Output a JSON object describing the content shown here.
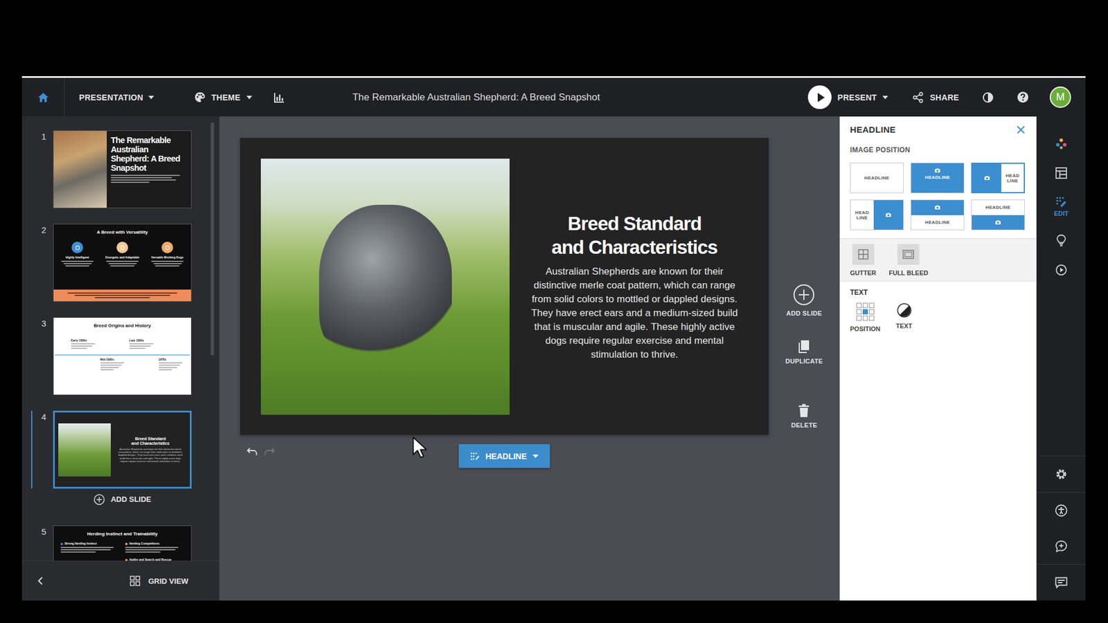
{
  "top_bar": {
    "presentation_menu": "PRESENTATION",
    "theme_menu": "THEME",
    "title": "The Remarkable Australian Shepherd: A Breed Snapshot",
    "present": "PRESENT",
    "share": "SHARE",
    "avatar": "M"
  },
  "sidebar": {
    "slides": [
      {
        "number": "1",
        "kind": "title",
        "selected": false,
        "title": "The Remarkable Australian Shepherd: A Breed Snapshot"
      },
      {
        "number": "2",
        "kind": "three-icons",
        "selected": false,
        "title": "A Breed with Versatility",
        "items": [
          {
            "label": "Highly Intelligent",
            "color": "#3d8fd6"
          },
          {
            "label": "Energetic and Adaptable",
            "color": "#f5c894"
          },
          {
            "label": "Versatile Working Dogs",
            "color": "#f1a96a"
          }
        ]
      },
      {
        "number": "3",
        "kind": "timeline",
        "selected": false,
        "title": "Breed Origins and History",
        "items": [
          {
            "label": "Early 1800s"
          },
          {
            "label": "Mid-1900s"
          },
          {
            "label": "Late 1800s"
          },
          {
            "label": "1970s"
          }
        ]
      },
      {
        "number": "4",
        "kind": "headline",
        "selected": true
      },
      {
        "number": "5",
        "kind": "two-column",
        "selected": false,
        "title": "Herding Instinct and Trainability",
        "columns": [
          [
            {
              "label": "Strong Herding Instinct",
              "color": "#3d8fd6"
            }
          ],
          [
            {
              "label": "Herding Competitions",
              "color": "#f1a96a"
            },
            {
              "label": "Agility and Search and Rescue",
              "color": "#f1a96a"
            }
          ]
        ]
      }
    ],
    "add_slide": "ADD SLIDE",
    "grid_view": "GRID VIEW"
  },
  "canvas": {
    "slide": {
      "headline": [
        "Breed Standard",
        "and Characteristics"
      ],
      "body": "Australian Shepherds are known for their distinctive merle coat pattern, which can range from solid colors to mottled or dappled designs. They have erect ears and a medium-sized build that is muscular and agile. These highly active dogs require regular exercise and mental stimulation to thrive."
    },
    "actions": [
      {
        "label": "ADD SLIDE",
        "kind": "add"
      },
      {
        "label": "DUPLICATE",
        "kind": "duplicate"
      },
      {
        "label": "DELETE",
        "kind": "delete"
      }
    ],
    "undo": {
      "disabled": false
    },
    "redo": {
      "disabled": true
    },
    "element_button": "HEADLINE"
  },
  "panel": {
    "title": "HEADLINE",
    "image_position_label": "IMAGE POSITION",
    "layouts": [
      {
        "kind": "none",
        "lines": [
          "HEADLINE"
        ],
        "selected": false
      },
      {
        "kind": "background",
        "lines": [
          "HEADLINE"
        ],
        "selected": false
      },
      {
        "kind": "left",
        "lines": [
          "HEAD",
          "LINE"
        ],
        "selected": true
      },
      {
        "kind": "right",
        "lines": [
          "HEAD",
          "LINE"
        ],
        "selected": false
      },
      {
        "kind": "top",
        "lines": [
          "HEADLINE"
        ],
        "selected": false
      },
      {
        "kind": "bottom",
        "lines": [
          "HEADLINE"
        ],
        "selected": false
      }
    ],
    "image_tools": [
      {
        "label": "GUTTER",
        "kind": "gutter"
      },
      {
        "label": "FULL BLEED",
        "kind": "full-bleed"
      }
    ],
    "text_label": "TEXT",
    "text_tools": [
      {
        "label": "POSITION",
        "kind": "position",
        "cells": [
          false,
          false,
          false,
          false,
          true,
          false,
          false,
          false,
          false
        ]
      },
      {
        "label": "TEXT",
        "kind": "text"
      }
    ]
  },
  "rail": {
    "top": [
      {
        "kind": "sparkle",
        "selected": false
      },
      {
        "kind": "layout",
        "selected": false
      },
      {
        "kind": "edit",
        "label": "EDIT",
        "selected": true
      },
      {
        "kind": "idea",
        "selected": false
      },
      {
        "kind": "play",
        "selected": false
      }
    ],
    "bottom": [
      {
        "kind": "settings"
      },
      {
        "kind": "accessibility"
      },
      {
        "kind": "comment"
      },
      {
        "kind": "notes"
      }
    ]
  }
}
